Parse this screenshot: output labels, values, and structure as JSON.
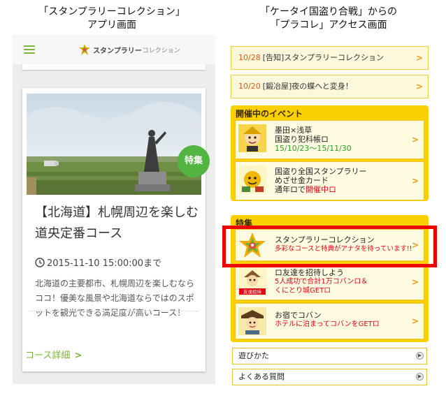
{
  "captions": {
    "left_line1": "「スタンプラリーコレクション」",
    "left_line2": "アプリ画面",
    "right_line1": "「ケータイ国盗り合戦」からの",
    "right_line2": "「プラコレ」アクセス画面"
  },
  "left_app": {
    "logo_text": "スタンプラリー",
    "logo_sub": "コレクション",
    "card": {
      "badge": "特集",
      "title": "【北海道】札幌周辺を楽しむ道央定番コース",
      "date": "2015-11-10 15:00:00まで",
      "description": "北海道の主要都市、札幌周辺を楽しむならココ！優美な風景や北海道ならではのスポットを観光できる満足度が高いコース！",
      "link": "コース詳細",
      "link_chevron": ">"
    }
  },
  "right_app": {
    "news": [
      {
        "date": "10/28",
        "text": "[告知]スタンプラリーコレクション"
      },
      {
        "date": "10/20",
        "text": "[鍛冶屋]夜の蝶へと変身！"
      }
    ],
    "events_section": {
      "title": "開催中のイベント",
      "items": [
        {
          "line1": "墨田×浅草",
          "line2": "国盗り犯科帳ロ",
          "line3": "15/10/23〜15/11/30"
        },
        {
          "line1": "国盗り全国スタンプラリー",
          "line2": "めざせ金カード",
          "line3_a": "通年ロで",
          "line3_b": "開催中ロ"
        }
      ]
    },
    "special_section": {
      "title": "特集",
      "items": [
        {
          "line1": "スタンプラリーコレクション",
          "line2": "多彩なコースと特典がアナタを待っています!!"
        },
        {
          "line1": "ロ友達を招待しよう",
          "line2": "5人成功で合計1万コバンロ＆",
          "line3": "くにとり城GETロ",
          "thumb_label": "友達招待"
        },
        {
          "line1": "お宿でコバン",
          "line2": "ホテルに泊まってコバンをGETロ"
        }
      ]
    },
    "footer": [
      {
        "label": "遊びかた"
      },
      {
        "label": "よくある質問"
      }
    ],
    "chevron": ">",
    "circle_chevron": "▶"
  },
  "colors": {
    "app_green": "#7ab436",
    "badge_green": "#52b441",
    "section_yellow": "#fbd000",
    "highlight_red": "#ee0000",
    "date_orange": "#e3590f"
  }
}
